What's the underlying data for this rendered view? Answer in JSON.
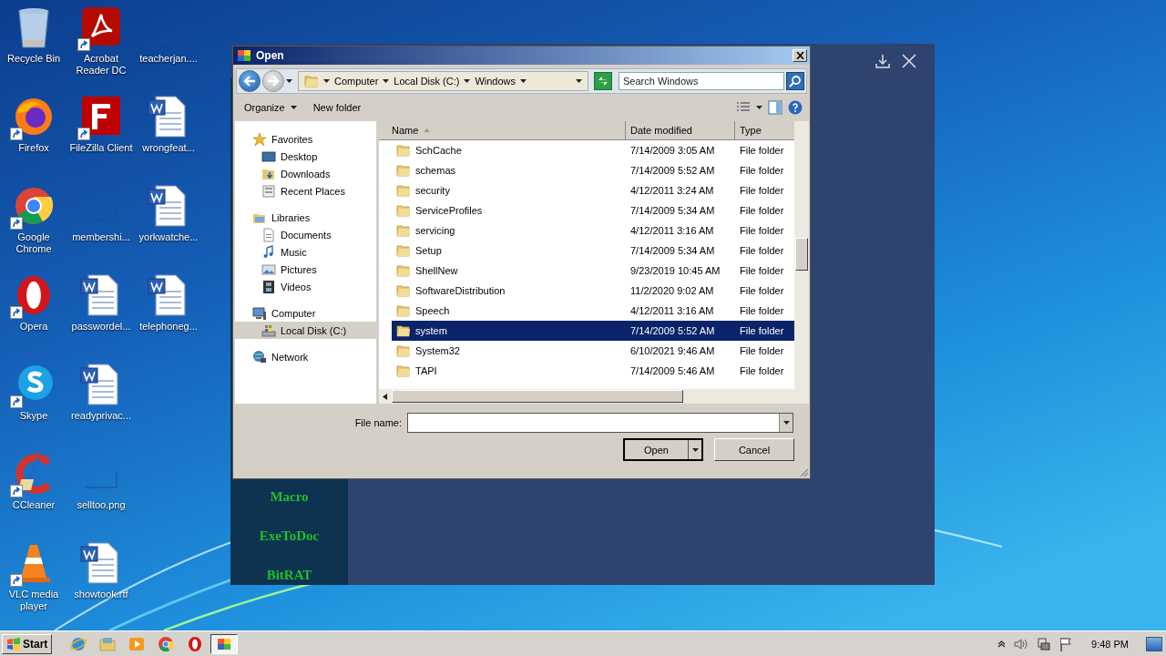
{
  "desktop": {
    "icon_rows": [
      [
        {
          "label": "Recycle Bin",
          "kind": "recycle-bin",
          "shortcut": false
        },
        {
          "label": "Acrobat Reader DC",
          "kind": "acrobat",
          "shortcut": true
        },
        {
          "label": "teacherjan....",
          "kind": "blank",
          "shortcut": false
        }
      ],
      [
        {
          "label": "Firefox",
          "kind": "firefox",
          "shortcut": true
        },
        {
          "label": "FileZilla Client",
          "kind": "filezilla",
          "shortcut": true
        },
        {
          "label": "wrongfeat...",
          "kind": "word",
          "shortcut": false
        }
      ],
      [
        {
          "label": "Google Chrome",
          "kind": "chrome",
          "shortcut": true
        },
        {
          "label": "membershi...",
          "kind": "blank",
          "shortcut": false
        },
        {
          "label": "yorkwatche...",
          "kind": "word",
          "shortcut": false
        }
      ],
      [
        {
          "label": "Opera",
          "kind": "opera",
          "shortcut": true
        },
        {
          "label": "passwordel...",
          "kind": "word",
          "shortcut": false
        },
        {
          "label": "telephoneg...",
          "kind": "word",
          "shortcut": false
        }
      ],
      [
        {
          "label": "Skype",
          "kind": "skype",
          "shortcut": true
        },
        {
          "label": "readyprivac...",
          "kind": "word",
          "shortcut": false
        }
      ],
      [
        {
          "label": "CCleaner",
          "kind": "ccleaner",
          "shortcut": true
        },
        {
          "label": "selltoo.png",
          "kind": "blank",
          "shortcut": false
        }
      ],
      [
        {
          "label": "VLC media player",
          "kind": "vlc",
          "shortcut": true
        },
        {
          "label": "showtook.rtf",
          "kind": "word",
          "shortcut": false
        }
      ]
    ]
  },
  "app_window": {
    "sidebar_items": [
      "Macro",
      "ExeToDoc",
      "BitRAT"
    ]
  },
  "dialog": {
    "title": "Open",
    "breadcrumb": [
      "Computer",
      "Local Disk (C:)",
      "Windows"
    ],
    "search": {
      "placeholder": "Search Windows"
    },
    "toolbar": [
      {
        "label": "Organize",
        "kind": "menu"
      },
      {
        "label": "New folder",
        "kind": "button"
      }
    ],
    "nav": [
      {
        "label": "Favorites",
        "kind": "star",
        "selected": false,
        "children": [
          {
            "label": "Desktop",
            "kind": "desktop",
            "selected": false
          },
          {
            "label": "Downloads",
            "kind": "downloads",
            "selected": false
          },
          {
            "label": "Recent Places",
            "kind": "recent",
            "selected": false
          }
        ]
      },
      {
        "label": "Libraries",
        "kind": "library",
        "selected": false,
        "children": [
          {
            "label": "Documents",
            "kind": "documents",
            "selected": false
          },
          {
            "label": "Music",
            "kind": "music",
            "selected": false
          },
          {
            "label": "Pictures",
            "kind": "pictures",
            "selected": false
          },
          {
            "label": "Videos",
            "kind": "videos",
            "selected": false
          }
        ]
      },
      {
        "label": "Computer",
        "kind": "computer",
        "selected": false,
        "children": [
          {
            "label": "Local Disk (C:)",
            "kind": "disk",
            "selected": true
          }
        ]
      },
      {
        "label": "Network",
        "kind": "network",
        "selected": false
      }
    ],
    "columns": [
      "Name",
      "Date modified",
      "Type"
    ],
    "rows": [
      {
        "name": "SchCache",
        "date": "7/14/2009 3:05 AM",
        "type": "File folder",
        "selected": false
      },
      {
        "name": "schemas",
        "date": "7/14/2009 5:52 AM",
        "type": "File folder",
        "selected": false
      },
      {
        "name": "security",
        "date": "4/12/2011 3:24 AM",
        "type": "File folder",
        "selected": false
      },
      {
        "name": "ServiceProfiles",
        "date": "7/14/2009 5:34 AM",
        "type": "File folder",
        "selected": false
      },
      {
        "name": "servicing",
        "date": "4/12/2011 3:16 AM",
        "type": "File folder",
        "selected": false
      },
      {
        "name": "Setup",
        "date": "7/14/2009 5:34 AM",
        "type": "File folder",
        "selected": false
      },
      {
        "name": "ShellNew",
        "date": "9/23/2019 10:45 AM",
        "type": "File folder",
        "selected": false
      },
      {
        "name": "SoftwareDistribution",
        "date": "11/2/2020 9:02 AM",
        "type": "File folder",
        "selected": false
      },
      {
        "name": "Speech",
        "date": "4/12/2011 3:16 AM",
        "type": "File folder",
        "selected": false
      },
      {
        "name": "system",
        "date": "7/14/2009 5:52 AM",
        "type": "File folder",
        "selected": true
      },
      {
        "name": "System32",
        "date": "6/10/2021 9:46 AM",
        "type": "File folder",
        "selected": false
      },
      {
        "name": "TAPI",
        "date": "7/14/2009 5:46 AM",
        "type": "File folder",
        "selected": false
      }
    ],
    "file_name_label": "File name:",
    "buttons": {
      "open": "Open",
      "cancel": "Cancel"
    }
  },
  "taskbar": {
    "start": "Start",
    "items": [
      {
        "kind": "ie",
        "selected": false
      },
      {
        "kind": "explorer",
        "selected": false
      },
      {
        "kind": "media",
        "selected": false
      },
      {
        "kind": "chrome",
        "selected": false
      },
      {
        "kind": "opera",
        "selected": false
      },
      {
        "kind": "window",
        "selected": true
      }
    ],
    "clock": "9:48 PM"
  }
}
